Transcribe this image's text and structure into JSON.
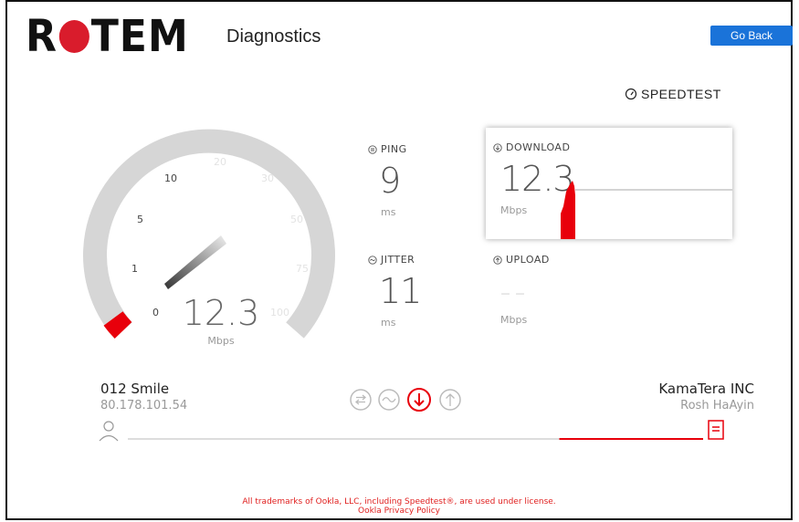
{
  "header": {
    "logo_text": "ROTEM",
    "page_title": "Diagnostics",
    "go_back_label": "Go Back"
  },
  "brand": {
    "speedtest_label": "SPEEDTEST"
  },
  "gauge": {
    "value": "12.3",
    "unit": "Mbps",
    "ticks": [
      "0",
      "1",
      "5",
      "10",
      "20",
      "30",
      "50",
      "75",
      "100"
    ],
    "accent_color": "#e8000b"
  },
  "metrics": {
    "ping": {
      "label": "PING",
      "value": "9",
      "unit": "ms"
    },
    "jitter": {
      "label": "JITTER",
      "value": "11",
      "unit": "ms"
    },
    "download": {
      "label": "DOWNLOAD",
      "value": "12.3",
      "unit": "Mbps"
    },
    "upload": {
      "label": "UPLOAD",
      "value": "– –",
      "unit": "Mbps"
    }
  },
  "isp": {
    "name": "012 Smile",
    "ip": "80.178.101.54"
  },
  "server": {
    "name": "KamaTera INC",
    "location": "Rosh HaAyin"
  },
  "progress": {
    "fraction_complete": 0.75,
    "active_stage": "download"
  },
  "footer": {
    "line1": "All trademarks of Ookla, LLC, including Speedtest®, are used under license.",
    "line2": "Ookla Privacy Policy"
  },
  "colors": {
    "accent": "#e8000b",
    "button": "#1a73d9"
  },
  "icons": [
    "speedtest-gauge-icon",
    "ping-icon",
    "jitter-icon",
    "download-icon",
    "upload-icon",
    "user-icon",
    "server-doc-icon"
  ]
}
